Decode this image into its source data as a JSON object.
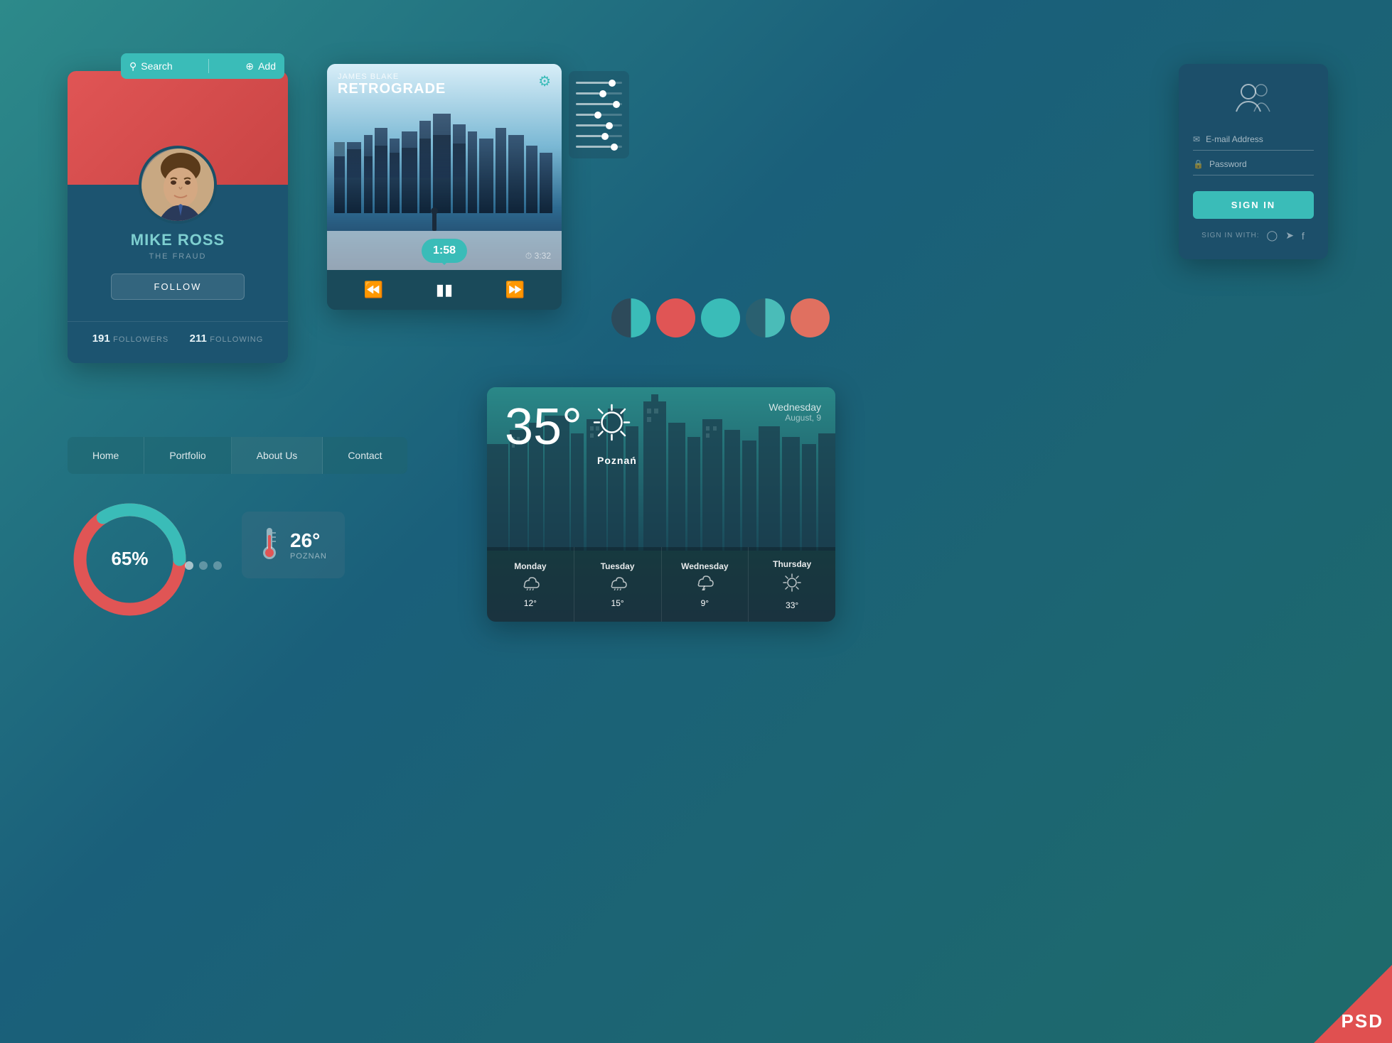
{
  "page": {
    "background_start": "#2d8a8a",
    "background_end": "#1a5f7a"
  },
  "search_bar": {
    "search_label": "Search",
    "add_label": "Add"
  },
  "profile": {
    "name": "MIKE ROSS",
    "subtitle": "THE FRAUD",
    "follow_label": "FOLLOW",
    "followers_count": "191",
    "followers_label": "FOLLOWERS",
    "following_count": "211",
    "following_label": "FOLLOWING"
  },
  "music_player": {
    "artist": "JAMES BLAKE",
    "title": "RETROGRADE",
    "current_time": "1:58",
    "total_time": "3:32"
  },
  "login": {
    "email_placeholder": "E-mail Address",
    "password_placeholder": "Password",
    "signin_label": "SIGN IN",
    "signin_with_label": "SIGN IN WITH:"
  },
  "navigation": {
    "items": [
      {
        "label": "Home"
      },
      {
        "label": "Portfolio"
      },
      {
        "label": "About Us"
      },
      {
        "label": "Contact"
      }
    ]
  },
  "donut": {
    "percent": "65%"
  },
  "thermometer": {
    "temp": "26°",
    "city": "POZNAN"
  },
  "weather": {
    "temp": "35",
    "unit": "°",
    "city": "Poznań",
    "day": "Wednesday",
    "date": "August, 9",
    "forecast": [
      {
        "day": "Monday",
        "temp": "12°",
        "icon": "cloud-rain"
      },
      {
        "day": "Tuesday",
        "temp": "15°",
        "icon": "cloud-rain"
      },
      {
        "day": "Wednesday",
        "temp": "9°",
        "icon": "cloud-lightning"
      },
      {
        "day": "Thursday",
        "temp": "33°",
        "icon": "sun"
      }
    ]
  },
  "color_swatches": [
    {
      "color": "#2d4a5a",
      "half": true
    },
    {
      "color": "#e05555"
    },
    {
      "color": "#3abcb8"
    },
    {
      "color": "#2a7a7a",
      "half2": true
    },
    {
      "color": "#e07060"
    }
  ],
  "psd_badge": {
    "label": "PSD"
  },
  "eq_sliders": [
    {
      "fill": 70
    },
    {
      "fill": 50
    },
    {
      "fill": 80
    },
    {
      "fill": 40
    },
    {
      "fill": 65
    },
    {
      "fill": 55
    },
    {
      "fill": 75
    }
  ]
}
